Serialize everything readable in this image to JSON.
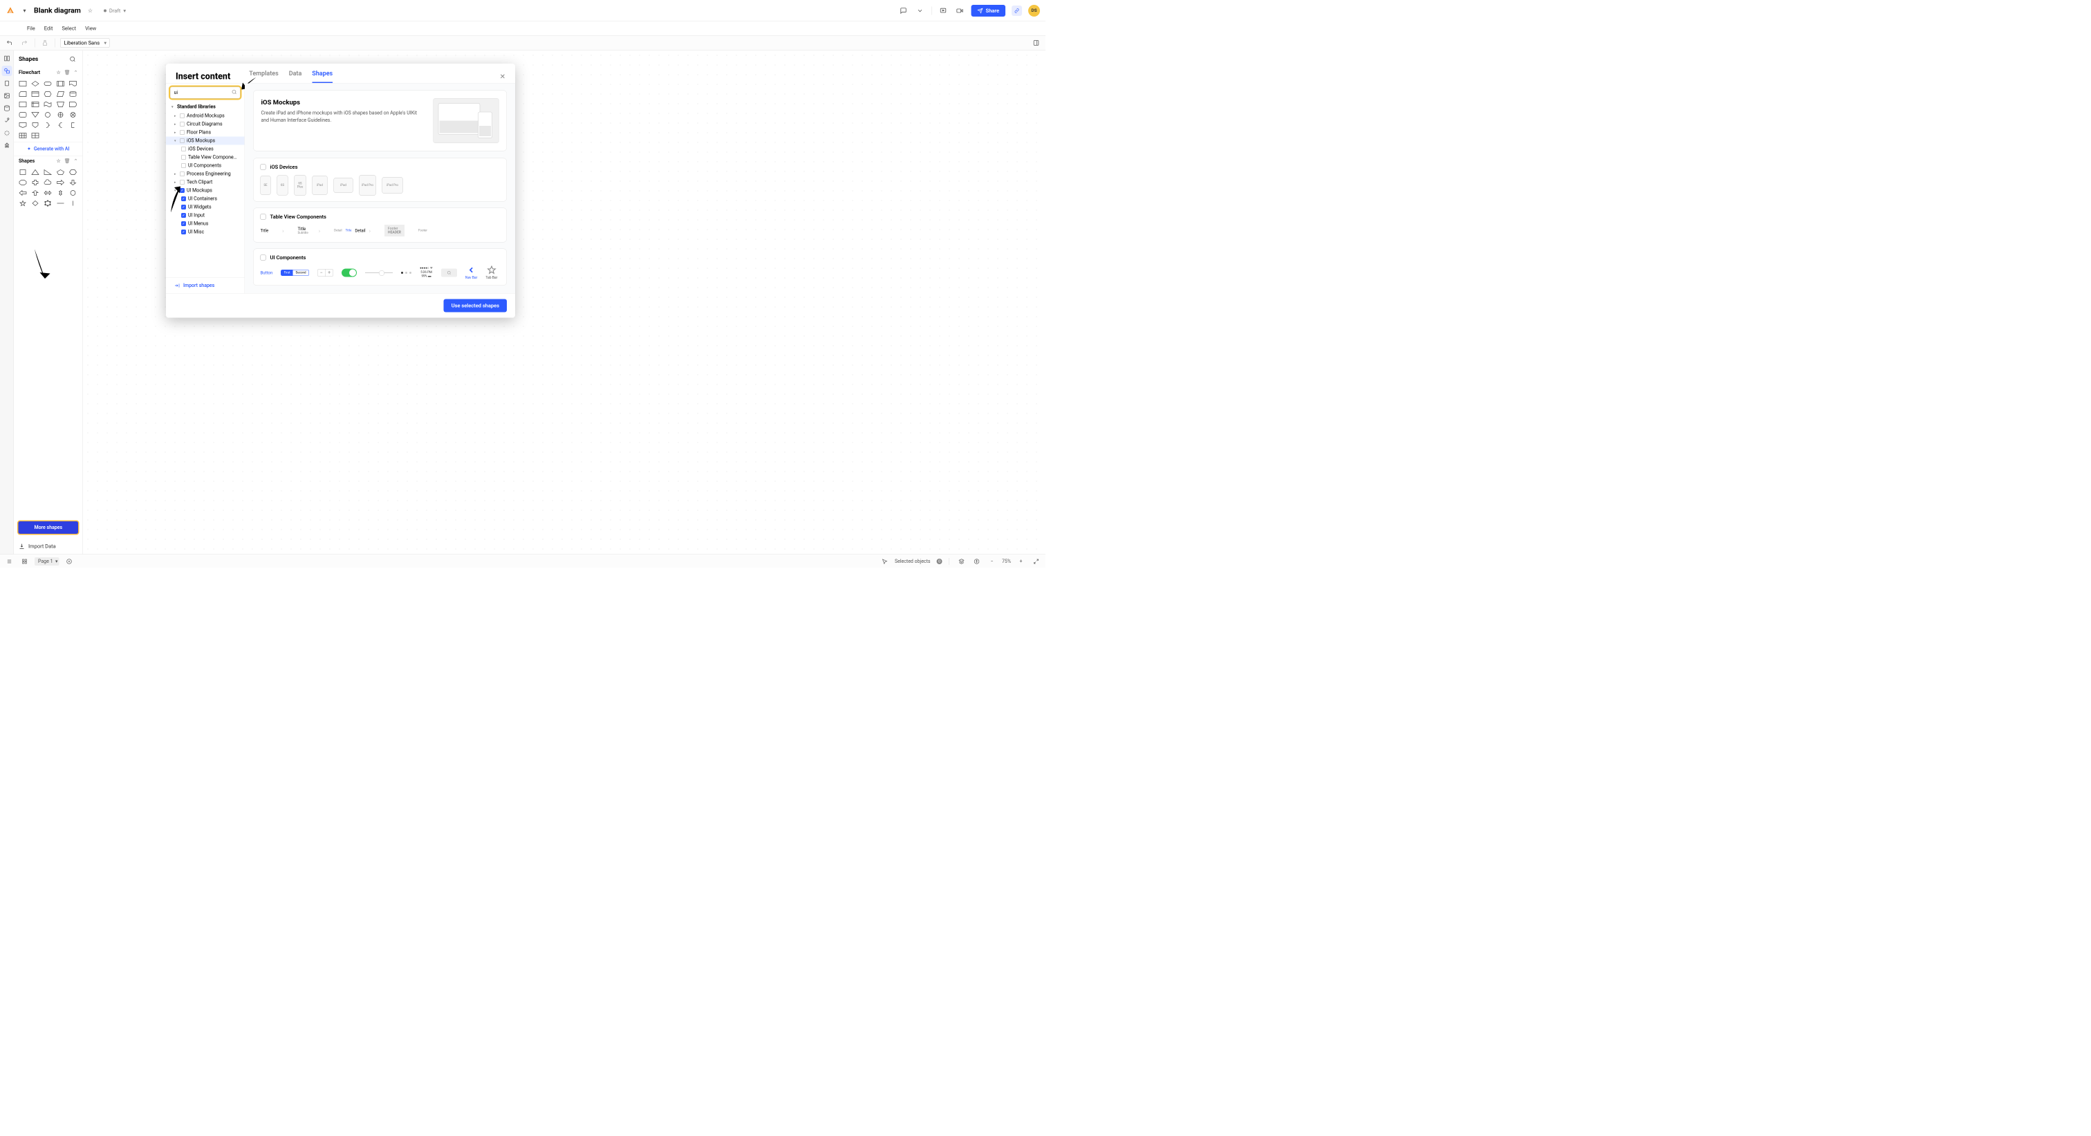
{
  "doc": {
    "title": "Blank diagram",
    "status": "Draft"
  },
  "menu": {
    "file": "File",
    "edit": "Edit",
    "select": "Select",
    "view": "View"
  },
  "toolbar": {
    "font": "Liberation Sans"
  },
  "share": {
    "label": "Share"
  },
  "avatar": {
    "initials": "DS"
  },
  "shapes_panel": {
    "title": "Shapes",
    "section_flowchart": "Flowchart",
    "section_shapes": "Shapes",
    "generate_ai": "Generate with AI",
    "more_shapes": "More shapes",
    "import_data": "Import Data"
  },
  "statusbar": {
    "page": "Page 1",
    "selected": "Selected objects",
    "selected_count": "0",
    "zoom": "75%"
  },
  "modal": {
    "title": "Insert content",
    "tabs": {
      "templates": "Templates",
      "data": "Data",
      "shapes": "Shapes"
    },
    "search_value": "ui",
    "tree": {
      "header": "Standard libraries",
      "android": "Android Mockups",
      "circuit": "Circuit Diagrams",
      "floor": "Floor Plans",
      "ios": "iOS Mockups",
      "ios_devices": "iOS Devices",
      "tvc": "Table View Compone…",
      "ui_components": "UI Components",
      "process": "Process Engineering",
      "clipart": "Tech Clipart",
      "ui_mockups": "UI Mockups",
      "ui_containers": "UI Containers",
      "ui_widgets": "UI Widgets",
      "ui_input": "UI Input",
      "ui_menus": "UI Menus",
      "ui_misc": "UI Misc"
    },
    "import_shapes": "Import shapes",
    "feature": {
      "title": "iOS Mockups",
      "desc": "Create iPad and iPhone mockups with iOS shapes based on Apple's UIKit and Human Interface Guidelines."
    },
    "groups": {
      "ios_devices": "iOS Devices",
      "tvc": "Table View Components",
      "ui_components": "UI Components"
    },
    "devices": {
      "se": "SE",
      "six": "6S",
      "sixplus": "6S Plus",
      "ipad": "iPad",
      "ipad2": "iPad",
      "ipadpro": "iPad Pro",
      "ipadpro2": "iPad Pro"
    },
    "tvc_items": {
      "title1": "Title",
      "title2": "Title",
      "subtitle": "Subtitle",
      "detail": "Detail",
      "title_small": "Title",
      "detail2": "Detail",
      "footer": "Footer",
      "header": "HEADER",
      "footer2": "Footer"
    },
    "ui_comp": {
      "button": "Button",
      "seg_first": "First",
      "seg_second": "Second",
      "time": "5:26 PM",
      "battery": "99%",
      "navbar": "Nav Bar",
      "tabbar": "Tab Bar"
    },
    "footer_btn": "Use selected shapes"
  }
}
